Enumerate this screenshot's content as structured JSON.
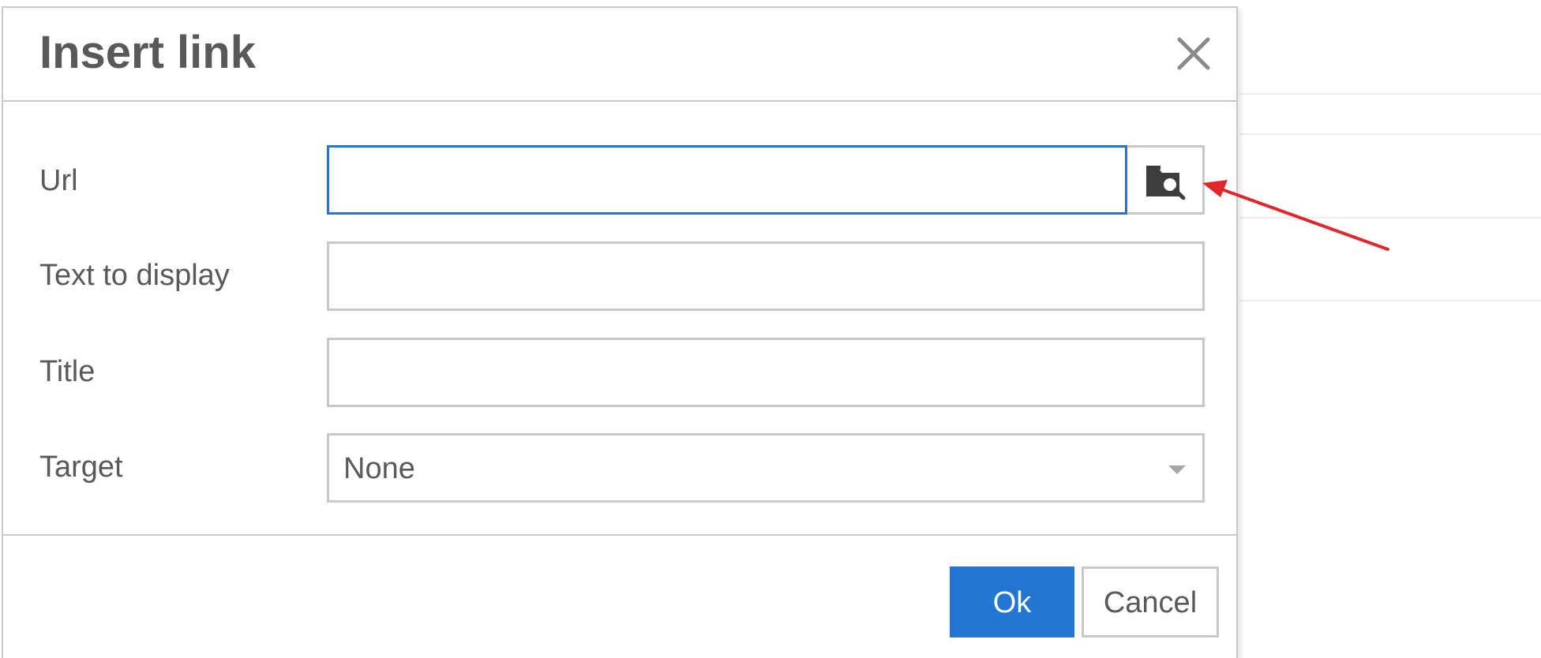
{
  "dialog": {
    "title": "Insert link",
    "close_icon": "close-icon"
  },
  "form": {
    "url": {
      "label": "Url",
      "value": "",
      "browse_icon": "folder-search-icon"
    },
    "text_to_display": {
      "label": "Text to display",
      "value": ""
    },
    "title": {
      "label": "Title",
      "value": ""
    },
    "target": {
      "label": "Target",
      "selected": "None",
      "caret_icon": "caret-down-icon"
    }
  },
  "footer": {
    "ok_label": "Ok",
    "cancel_label": "Cancel"
  },
  "colors": {
    "accent": "#2276d2",
    "border": "#c8c8c8",
    "text": "#595959",
    "annotation_arrow": "#e0262b"
  }
}
